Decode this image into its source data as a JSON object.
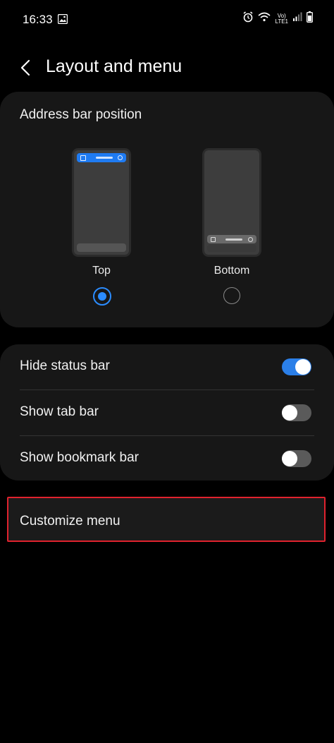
{
  "status_bar": {
    "time": "16:33",
    "volte_line1": "Vo)",
    "volte_line2": "LTE1"
  },
  "header": {
    "title": "Layout and menu"
  },
  "address_bar": {
    "section_label": "Address bar position",
    "options": [
      {
        "label": "Top",
        "selected": true
      },
      {
        "label": "Bottom",
        "selected": false
      }
    ]
  },
  "toggles": [
    {
      "label": "Hide status bar",
      "on": true
    },
    {
      "label": "Show tab bar",
      "on": false
    },
    {
      "label": "Show bookmark bar",
      "on": false
    }
  ],
  "customize_menu": {
    "label": "Customize menu"
  },
  "colors": {
    "accent": "#2b7fe8",
    "highlight_border": "#e0222e",
    "card": "#171717",
    "background": "#000000"
  }
}
